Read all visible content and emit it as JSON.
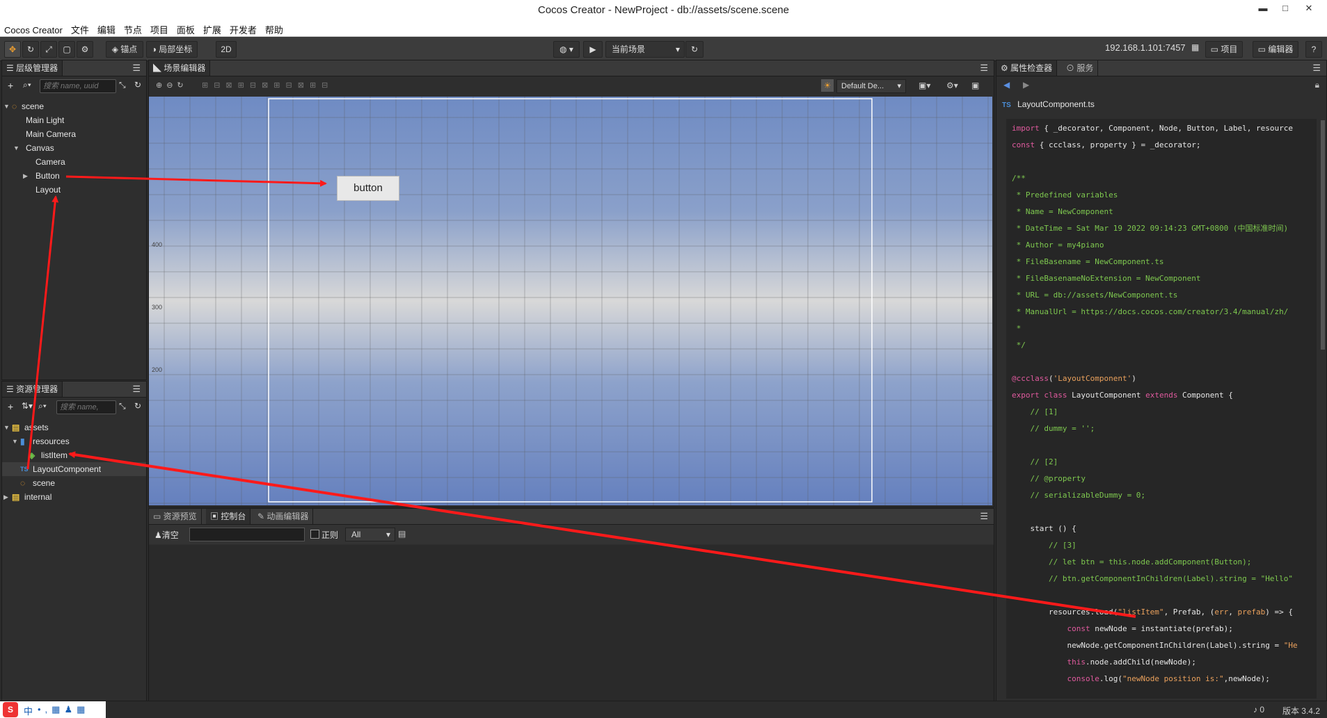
{
  "window": {
    "title": "Cocos Creator - NewProject - db://assets/scene.scene",
    "minimize": "▬",
    "maximize": "□",
    "close": "✕"
  },
  "menu": [
    "Cocos Creator",
    "文件",
    "编辑",
    "节点",
    "项目",
    "面板",
    "扩展",
    "开发者",
    "帮助"
  ],
  "toolbar": {
    "anchor_label": "锚点",
    "local_coord_label": "局部坐标",
    "mode_2d": "2D",
    "scene_select": "当前场景",
    "ip_address": "192.168.1.101:7457",
    "project_btn": "项目",
    "editor_btn": "编辑器"
  },
  "hierarchy": {
    "title": "层级管理器",
    "search_placeholder": "搜索 name, uuid",
    "items": [
      {
        "label": "scene",
        "depth": 0,
        "expanded": true
      },
      {
        "label": "Main Light",
        "depth": 1
      },
      {
        "label": "Main Camera",
        "depth": 1
      },
      {
        "label": "Canvas",
        "depth": 1,
        "expanded": true
      },
      {
        "label": "Camera",
        "depth": 2
      },
      {
        "label": "Button",
        "depth": 2,
        "collapsed": true
      },
      {
        "label": "Layout",
        "depth": 2
      }
    ]
  },
  "assets": {
    "title": "资源管理器",
    "search_placeholder": "搜索 name,",
    "items": [
      {
        "label": "assets",
        "depth": 0
      },
      {
        "label": "resources",
        "depth": 1
      },
      {
        "label": "listItem",
        "depth": 2
      },
      {
        "label": "LayoutComponent",
        "depth": 1,
        "prefix": "TS"
      },
      {
        "label": "scene",
        "depth": 1
      },
      {
        "label": "internal",
        "depth": 0
      }
    ]
  },
  "scene_editor": {
    "title": "场景编辑器",
    "camera_select": "Default De...",
    "button_label": "button",
    "y_ticks": [
      "400",
      "300",
      "200"
    ]
  },
  "console": {
    "tabs": [
      "资源预览",
      "控制台",
      "动画编辑器"
    ],
    "clear_label": "清空",
    "regex_label": "正则",
    "level_select": "All"
  },
  "inspector": {
    "tabs": [
      "属性检查器",
      "服务"
    ],
    "file_prefix": "TS",
    "file_name": "LayoutComponent.ts",
    "code": [
      [
        [
          "kw",
          "import"
        ],
        [
          "df",
          " { _decorator, Component, Node, Button, Label, resource"
        ]
      ],
      [
        [
          "kw",
          "const"
        ],
        [
          "df",
          " { ccclass, property } = _decorator;"
        ]
      ],
      [],
      [
        [
          "cm",
          "/**"
        ]
      ],
      [
        [
          "cm",
          " * Predefined variables"
        ]
      ],
      [
        [
          "cm",
          " * Name = NewComponent"
        ]
      ],
      [
        [
          "cm",
          " * DateTime = Sat Mar 19 2022 09:14:23 GMT+0800 (中国标准时间)"
        ]
      ],
      [
        [
          "cm",
          " * Author = my4piano"
        ]
      ],
      [
        [
          "cm",
          " * FileBasename = NewComponent.ts"
        ]
      ],
      [
        [
          "cm",
          " * FileBasenameNoExtension = NewComponent"
        ]
      ],
      [
        [
          "cm",
          " * URL = db://assets/NewComponent.ts"
        ]
      ],
      [
        [
          "cm",
          " * ManualUrl = https://docs.cocos.com/creator/3.4/manual/zh/"
        ]
      ],
      [
        [
          "cm",
          " *"
        ]
      ],
      [
        [
          "cm",
          " */"
        ]
      ],
      [],
      [
        [
          "kw",
          "@ccclass"
        ],
        [
          "df",
          "("
        ],
        [
          "st",
          "'LayoutComponent'"
        ],
        [
          "df",
          ")"
        ]
      ],
      [
        [
          "kw",
          "export class"
        ],
        [
          "df",
          " LayoutComponent "
        ],
        [
          "kw",
          "extends"
        ],
        [
          "df",
          " Component {"
        ]
      ],
      [
        [
          "cm",
          "    // [1]"
        ]
      ],
      [
        [
          "cm",
          "    // dummy = '';"
        ]
      ],
      [],
      [
        [
          "cm",
          "    // [2]"
        ]
      ],
      [
        [
          "cm",
          "    // @property"
        ]
      ],
      [
        [
          "cm",
          "    // serializableDummy = 0;"
        ]
      ],
      [],
      [
        [
          "df",
          "    start () {"
        ]
      ],
      [
        [
          "cm",
          "        // [3]"
        ]
      ],
      [
        [
          "cm",
          "        // let btn = this.node.addComponent(Button);"
        ]
      ],
      [
        [
          "cm",
          "        // btn.getComponentInChildren(Label).string = \"Hello\""
        ]
      ],
      [],
      [
        [
          "df",
          "        resources.load("
        ],
        [
          "st",
          "\"listItem\""
        ],
        [
          "df",
          ", Prefab, ("
        ],
        [
          "st",
          "err"
        ],
        [
          "df",
          ", "
        ],
        [
          "st",
          "prefab"
        ],
        [
          "df",
          ") => {"
        ]
      ],
      [
        [
          "kw",
          "            const"
        ],
        [
          "df",
          " newNode = instantiate(prefab);"
        ]
      ],
      [
        [
          "df",
          "            newNode.getComponentInChildren(Label).string = "
        ],
        [
          "st",
          "\"He"
        ]
      ],
      [
        [
          "kw",
          "            this"
        ],
        [
          "df",
          ".node.addChild(newNode);"
        ]
      ],
      [
        [
          "kw",
          "            console"
        ],
        [
          "df",
          ".log("
        ],
        [
          "st",
          "\"newNode position is:\""
        ],
        [
          "df",
          ",newNode);"
        ]
      ]
    ]
  },
  "status": {
    "notifications": "0",
    "version": "版本 3.4.2"
  },
  "ime": {
    "brand": "S",
    "lang": "中"
  }
}
